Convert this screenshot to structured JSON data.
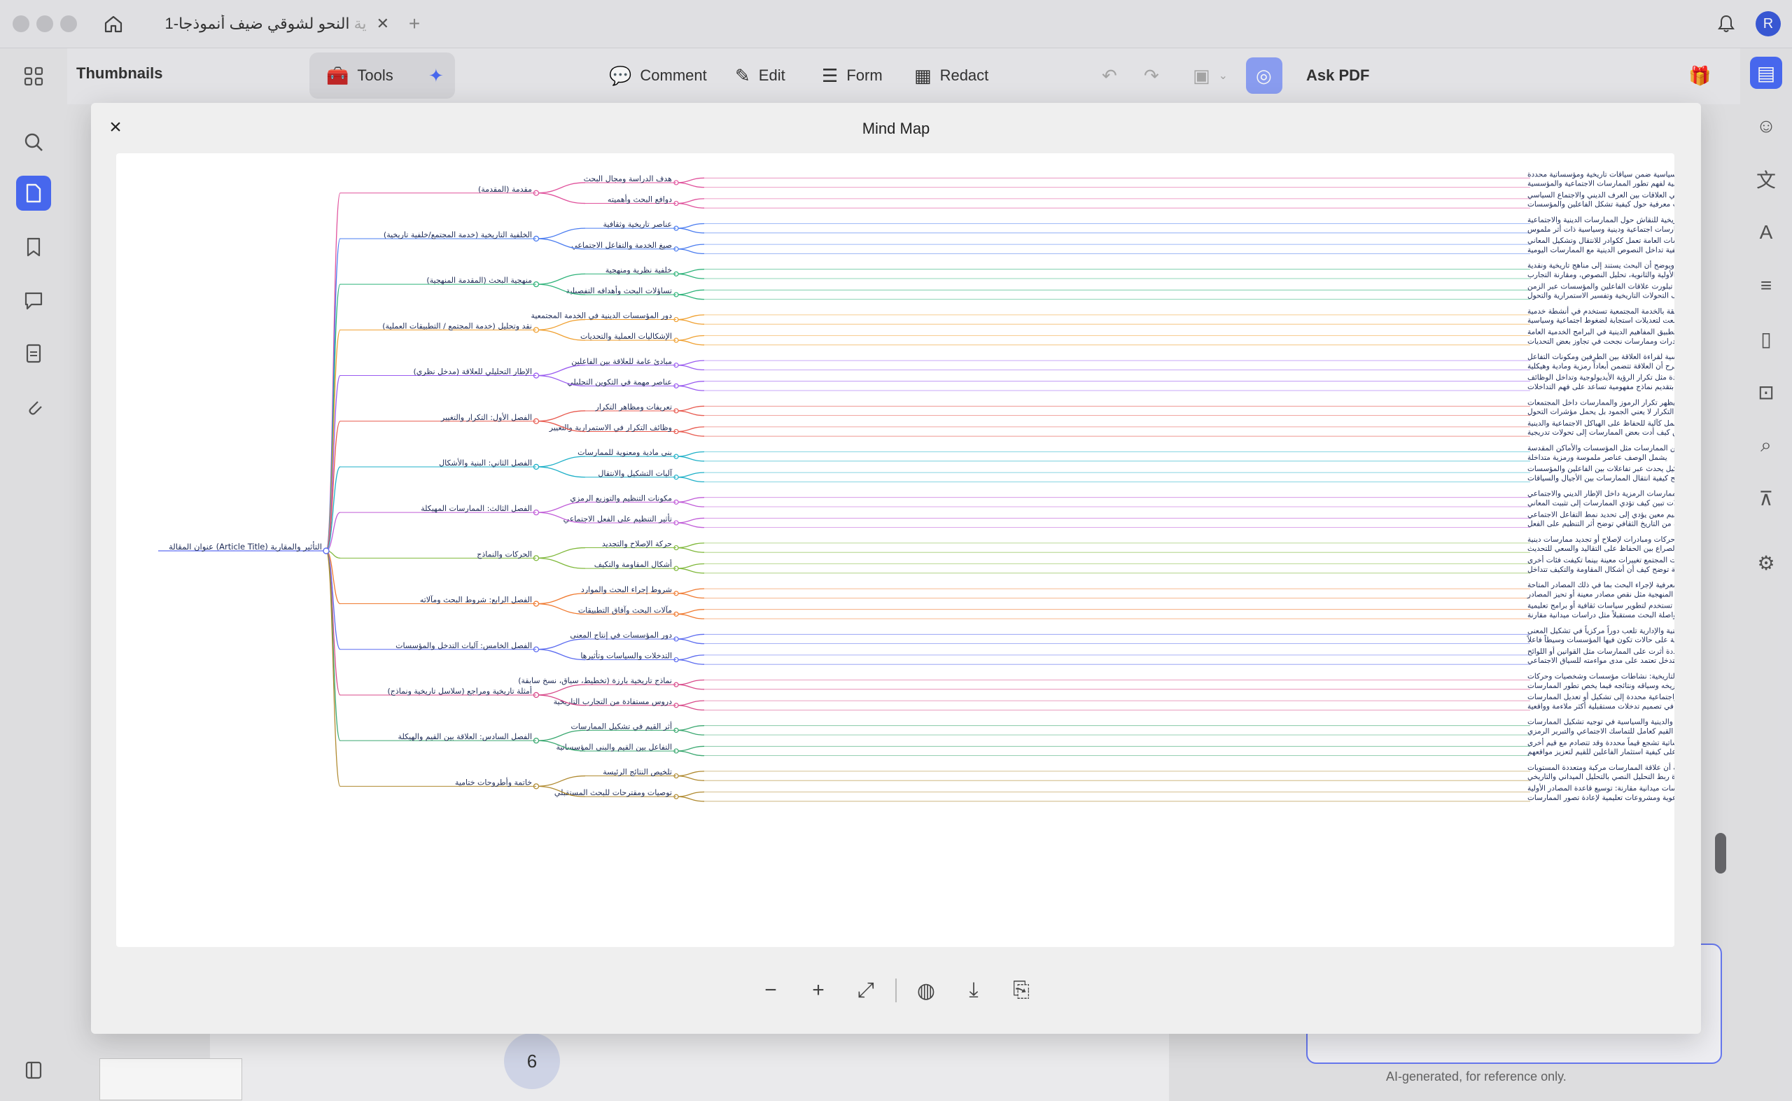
{
  "window": {
    "tab_title": "النحو لشوقي ضيف أنموذجا-1",
    "tab_prefix": "ية",
    "avatar_initial": "R"
  },
  "toolbar": {
    "panel_title": "Thumbnails",
    "tools_label": "Tools",
    "comment_label": "Comment",
    "edit_label": "Edit",
    "form_label": "Form",
    "redact_label": "Redact",
    "ask_pdf_label": "Ask PDF"
  },
  "modal": {
    "title": "Mind Map"
  },
  "mindmap": {
    "root": "عنوان المقالة (Article Title) التأثير والمقاربة",
    "branches": [
      {
        "label": "مقدمة (المقدمة)",
        "children": [
          {
            "label": "هدف الدراسة ومجال البحث",
            "leaves": [
              "تشرح المقدمة أن الدراسة تسعى إلى استقصاء التفاعلات بين علاقة البنى الثقافية والاجتماعية والدينية والسياسية ضمن سياقات تاريخية ومؤسساتية محددة",
              "تشير المقدمة إلى أن البحث يعتمد مقاربة تاريخية نقدية ومنهجية تحليلية لفهم تطور الممارسات الاجتماعية والمؤسسية"
            ]
          },
          {
            "label": "دوافع البحث وأهميته",
            "leaves": [
              "يحدد القسم دوافع إجراء الدراسة ومنها الغموض في العلاقات بين العرف الديني والاجتماع السياسي",
              "يؤكد القسم أن الدراسة تسهم في سد فجوات معرفية حول كيفية تشكل الفاعلين والمؤسسات"
            ]
          }
        ]
      },
      {
        "label": "الخلفية التاريخية (خدمة المجتمع/خلفية تاريخية)",
        "children": [
          {
            "label": "عناصر تاريخية وثقافية",
            "leaves": [
              "يستعرض هذا القسم الخلفية التاريخية للنقاش حول الممارسات الدينية والاجتماعية",
              "يبرز القسم أمثلة على ممارسات اجتماعية ودينية وسياسية ذات أثر ملموس"
            ]
          },
          {
            "label": "صيغ الخدمة والتفاعل الاجتماعي",
            "leaves": [
              "يوضح كيف أن النصوص والمؤسسات العامة تعمل ككوادر للانتقال وتشكيل المعاني",
              "يشير إلى أمثلة عملية لكيفية تداخل النصوص الدينية مع الممارسات اليومية"
            ]
          }
        ]
      },
      {
        "label": "منهجية البحث (المقدمة المنهجية)",
        "children": [
          {
            "label": "خلفية نظرية ومنهجية",
            "leaves": [
              "تعرض المقدمة المنهجية الإطار النظري للدراسة ويوضح أن البحث يستند إلى مناهج تاريخية ونقدية",
              "تحدد المنهجية خطوات البحث: تجميع المصادر الأولية والثانوية، تحليل النصوص، ومقارنة التجارب"
            ]
          },
          {
            "label": "تساؤلات البحث وأهدافه التفصيلية",
            "leaves": [
              "تذكر المقدمة أسئلة بحثية محددة: كيف تبلورت علاقات الفاعلين والمؤسسات عبر الزمن",
              "توضيح الأهداف التفصيلية مثل وصف التحولات التاريخية وتفسير الاستمرارية والتحول"
            ]
          }
        ]
      },
      {
        "label": "نقد وتحليل (خدمة المجتمع / التطبيقات العملية)",
        "children": [
          {
            "label": "دور المؤسسات الدينية في الخدمة المجتمعية",
            "leaves": [
              "يبين القسم أن الممارسات المتعلقة بالخدمة المجتمعية تستخدم في أنشطة خدمية",
              "يشير إلى أن بعض الممارسات خضعت لتعديلات استجابة لضغوط اجتماعية وسياسية"
            ]
          },
          {
            "label": "الإشكاليات العملية والتحديات",
            "leaves": [
              "يحدد القسم تحديات تطبيق المفاهيم الدينية في البرامج الخدمية العامة",
              "يقدم القسم أمثلة على مبادرات وممارسات نجحت في تجاوز بعض التحديات"
            ]
          }
        ]
      },
      {
        "label": "الإطار التحليلي للعلاقة (مدخل نظري)",
        "children": [
          {
            "label": "مبادئ عامة للعلاقة بين الفاعلين",
            "leaves": [
              "يقدم الفصل مبادئ أساسية لقراءة العلاقة بين الطرفين ومكونات التفاعل",
              "يشرح أن العلاقة تتضمن أبعاداً رمزية ومادية وهيكلية"
            ]
          },
          {
            "label": "عناصر مهمة في التكوين التحليلي",
            "leaves": [
              "يستعرض عناصر تحليلية محددة مثل تكرار الرؤية الأيديولوجية وتداخل الوظائف",
              "يقوم القسم بتقديم نماذج مفهومية تساعد على فهم التداخلات"
            ]
          }
        ]
      },
      {
        "label": "الفصل الأول: التكرار والتغيير",
        "children": [
          {
            "label": "تعريفات ومظاهر التكرار",
            "leaves": [
              "يشرح النص كيف يظهر تكرار الرموز والممارسات داخل المجتمعات",
              "يبرز أن التكرار لا يعني الجمود بل يحمل مؤشرات التحول"
            ]
          },
          {
            "label": "وظائف التكرار في الاستمرارية والتغيير",
            "leaves": [
              "يوضح أن التكرار يعمل كآلية للحفاظ على الهياكل الاجتماعية والدينية",
              "يقدم أمثلة تاريخية تبين كيف أدت بعض الممارسات إلى تحولات تدريجية"
            ]
          }
        ]
      },
      {
        "label": "الفصل الثاني: البنية والأشكال",
        "children": [
          {
            "label": "بنى مادية ومعنوية للممارسات",
            "leaves": [
              "يعرض تفاصيل عن البنى التي تتضمن الممارسات مثل المؤسسات والأماكن المقدسة",
              "يشمل الوصف عناصر ملموسة ورمزية متداخلة"
            ]
          },
          {
            "label": "آليات التشكيل والانتقال",
            "leaves": [
              "يبين أن التشكيل يحدث عبر تفاعلات بين الفاعلين والمؤسسات",
              "يقدم نماذج توضح كيفية انتقال الممارسات بين الأجيال والسياقات"
            ]
          }
        ]
      },
      {
        "label": "الفصل الثالث: الممارسات المهيكلة",
        "children": [
          {
            "label": "مكونات التنظيم والتوزيع الرمزي",
            "leaves": [
              "يوضح كيف تم تنظيم الممارسات الرمزية داخل الإطار الديني والاجتماعي",
              "يعرض حالات تبين كيف تؤدي الممارسات إلى تثبيت المعاني"
            ]
          },
          {
            "label": "تأثير التنظيم على الفعل الاجتماعي",
            "leaves": [
              "يبين أن اعتماد تنظيم معين يؤدي إلى تحديد نمط التفاعل الاجتماعي",
              "يسرد أمثلة من التاريخ الثقافي توضح أثر التنظيم على الفعل"
            ]
          }
        ]
      },
      {
        "label": "الحركات والنماذج",
        "children": [
          {
            "label": "حركة الإصلاح والتجديد",
            "leaves": [
              "يتناول هذا الجزء حركات ومبادرات لإصلاح أو تجديد ممارسات دينية",
              "يوضح عناصر الصراع بين الحفاظ على التقاليد والسعي للتحديث"
            ]
          },
          {
            "label": "أشكال المقاومة والتكيف",
            "leaves": [
              "يستعرض كيف قاومت بعض فئات المجتمع تغييرات معينة بينما تكيفت فئات أخرى",
              "يقدم أمثلة توضح كيف أن أشكال المقاومة والتكيف تتداخل"
            ]
          }
        ]
      },
      {
        "label": "الفصل الرابع: شروط البحث ومآلاته",
        "children": [
          {
            "label": "شروط إجراء البحث والموارد",
            "leaves": [
              "يصف القسم الشروط المادية والمعرفية لإجراء البحث بما في ذلك المصادر المتاحة",
              "يوضح التحديات المنهجية مثل نقص مصادر معينة أو تحيز المصادر"
            ]
          },
          {
            "label": "مآلات البحث وآفاق التطبيقات",
            "leaves": [
              "يناقش كيف يمكن لنتائج البحث أن تستخدم لتطوير سياسات ثقافية أو برامج تعليمية",
              "يقترح القسم طرقاً لمواصلة البحث مستقبلاً مثل دراسات ميدانية مقارنة"
            ]
          }
        ]
      },
      {
        "label": "الفصل الخامس: آليات التدخل والمؤسسات",
        "children": [
          {
            "label": "دور المؤسسات في إنتاج المعنى",
            "leaves": [
              "يشرح كيف أن المؤسسات الأكاديمية والدينية والإدارية تلعب دوراً مركزياً في تشكيل المعنى",
              "يقدم أمثلة على حالات تكون فيها المؤسسات وسيطاً فاعلاً"
            ]
          },
          {
            "label": "التدخلات والسياسات وتأثيرها",
            "leaves": [
              "يستعرض تدخلات سياسية وثقافية محددة أثرت على الممارسات مثل القوانين أو اللوائح",
              "يوضح أن فاعلية التدخل تعتمد على مدى مواءمته للسياق الاجتماعي"
            ]
          }
        ]
      },
      {
        "label": "أمثلة تاريخية ومراجع (سلاسل تاريخية ونماذج)",
        "children": [
          {
            "label": "نماذج تاريخية بارزة (تخطيط، سياق، نسخ سابقة)",
            "leaves": [
              "يعرض الفصل سلسلة من النماذج التاريخية: نشاطات مؤسسات وشخصيات وحركات",
              "لكل نموذج يقدم وصفاً لتاريخه وسياقه ونتائجه فيما يخص تطور الممارسات"
            ]
          },
          {
            "label": "دروس مستفادة من التجارب التاريخية",
            "leaves": [
              "يستخلص البحث دروساً حول كيف أدت ظروف سياسية واجتماعية محددة إلى تشكيل أو تعديل الممارسات",
              "يشير إلى أن فهم هذه التجارب يساعد في تصميم تدخلات مستقبلية أكثر ملاءمة وواقعية"
            ]
          }
        ]
      },
      {
        "label": "الفصل السادس: العلاقة بين القيم والهيكلة",
        "children": [
          {
            "label": "أثر القيم في تشكيل الممارسات",
            "leaves": [
              "يناقش دور القيم الأخلاقية والدينية والسياسية في توجيه تشكيل الممارسات",
              "يصف كيف تعمل القيم كعامل للتماسك الاجتماعي والتبرير الرمزي"
            ]
          },
          {
            "label": "التفاعل بين القيم والبنى المؤسساتية",
            "leaves": [
              "يبين أن البنى المؤسساتية تشجع قيماً محددة وقد تتصادم مع قيم أخرى",
              "يقدم أمثلة على كيفية استثمار الفاعلين للقيم لتعزيز مواقعهم"
            ]
          }
        ]
      },
      {
        "label": "خاتمة وأطروحات ختامية",
        "children": [
          {
            "label": "تلخيص النتائج الرئيسة",
            "leaves": [
              "تلخص الدراسة أن علاقة الممارسات مركبة ومتعددة المستويات",
              "تؤكد النتائج على ضرورة ربط التحليل النصي بالتحليل الميداني والتاريخي"
            ]
          },
          {
            "label": "توصيات ومقترحات للبحث المستقبلي",
            "leaves": [
              "توصي الدراسة بإجراء دراسات ميدانية مقارنة: توسيع قاعدة المصادر الأولية",
              "تقترح تطوير برامج توعوية ومشروعات تعليمية لإعادة تصور الممارسات"
            ]
          }
        ]
      }
    ]
  },
  "status": {
    "page_number": "6",
    "ai_note": "AI-generated, for reference only."
  }
}
